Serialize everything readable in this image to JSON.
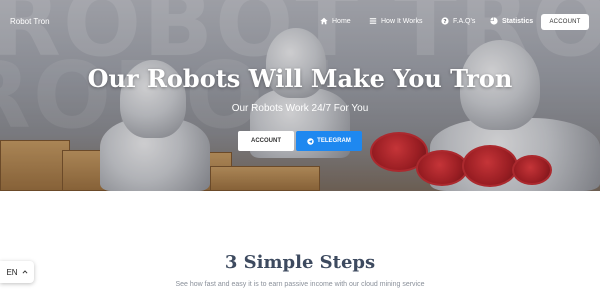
{
  "nav": {
    "brand": "Robot Tron",
    "items": [
      {
        "label": "Home",
        "icon": "home-icon"
      },
      {
        "label": "How It Works",
        "icon": "list-icon"
      },
      {
        "label": "F.A.Q's",
        "icon": "question-icon"
      },
      {
        "label": "Statistics",
        "icon": "pie-chart-icon"
      }
    ],
    "account_label": "ACCOUNT"
  },
  "hero": {
    "background_text": "ROBOT TRON",
    "title": "Our Robots Will Make You Tron",
    "subtitle": "Our Robots Work 24/7 For You",
    "account_button": "ACCOUNT",
    "telegram_button": "TELEGRAM",
    "telegram_icon": "telegram-icon",
    "telegram_color": "#1e88f0"
  },
  "steps": {
    "title": "3 Simple Steps",
    "subtitle": "See how fast and easy it is to earn passive income with our cloud mining service"
  },
  "language": {
    "selected": "EN",
    "icon": "chevron-up-icon"
  }
}
